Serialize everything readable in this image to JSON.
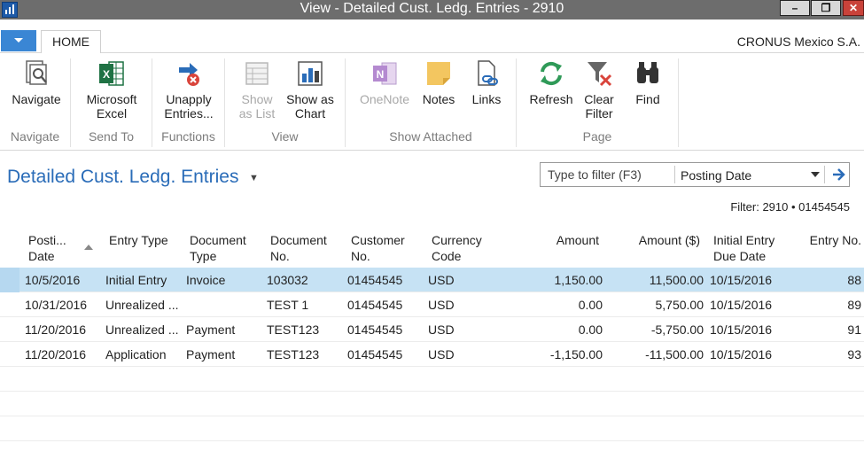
{
  "window": {
    "title": "View - Detailed Cust. Ledg. Entries - 2910",
    "minimize": "–",
    "maximize": "❐",
    "close": "✕"
  },
  "tabs": {
    "home": "HOME"
  },
  "company": "CRONUS Mexico S.A.",
  "ribbon": {
    "groups": {
      "navigate": "Navigate",
      "send_to": "Send To",
      "functions": "Functions",
      "view": "View",
      "show_attached": "Show Attached",
      "page": "Page"
    },
    "buttons": {
      "navigate": "Navigate",
      "excel_1": "Microsoft",
      "excel_2": "Excel",
      "unapply_1": "Unapply",
      "unapply_2": "Entries...",
      "show_list_1": "Show",
      "show_list_2": "as List",
      "show_chart_1": "Show as",
      "show_chart_2": "Chart",
      "onenote": "OneNote",
      "notes": "Notes",
      "links": "Links",
      "refresh": "Refresh",
      "clear_filter_1": "Clear",
      "clear_filter_2": "Filter",
      "find": "Find"
    }
  },
  "page": {
    "title": "Detailed Cust. Ledg. Entries",
    "filter_placeholder": "Type to filter (F3)",
    "filter_field": "Posting Date",
    "filter_note": "Filter: 2910 • 01454545"
  },
  "table": {
    "headers": {
      "posting_date_1": "Posti...",
      "posting_date_2": "Date",
      "entry_type": "Entry Type",
      "document_type_1": "Document",
      "document_type_2": "Type",
      "document_no_1": "Document",
      "document_no_2": "No.",
      "customer_no_1": "Customer",
      "customer_no_2": "No.",
      "currency_1": "Currency",
      "currency_2": "Code",
      "amount": "Amount",
      "amount_usd": "Amount ($)",
      "due_date_1": "Initial Entry",
      "due_date_2": "Due Date",
      "entry_no": "Entry No."
    },
    "rows": [
      {
        "posting_date": "10/5/2016",
        "entry_type": "Initial Entry",
        "document_type": "Invoice",
        "document_no": "103032",
        "customer_no": "01454545",
        "currency": "USD",
        "amount": "1,150.00",
        "amount_usd": "11,500.00",
        "due_date": "10/15/2016",
        "entry_no": "88"
      },
      {
        "posting_date": "10/31/2016",
        "entry_type": "Unrealized ...",
        "document_type": "",
        "document_no": "TEST 1",
        "customer_no": "01454545",
        "currency": "USD",
        "amount": "0.00",
        "amount_usd": "5,750.00",
        "due_date": "10/15/2016",
        "entry_no": "89"
      },
      {
        "posting_date": "11/20/2016",
        "entry_type": "Unrealized ...",
        "document_type": "Payment",
        "document_no": "TEST123",
        "customer_no": "01454545",
        "currency": "USD",
        "amount": "0.00",
        "amount_usd": "-5,750.00",
        "due_date": "10/15/2016",
        "entry_no": "91"
      },
      {
        "posting_date": "11/20/2016",
        "entry_type": "Application",
        "document_type": "Payment",
        "document_no": "TEST123",
        "customer_no": "01454545",
        "currency": "USD",
        "amount": "-1,150.00",
        "amount_usd": "-11,500.00",
        "due_date": "10/15/2016",
        "entry_no": "93"
      }
    ]
  }
}
